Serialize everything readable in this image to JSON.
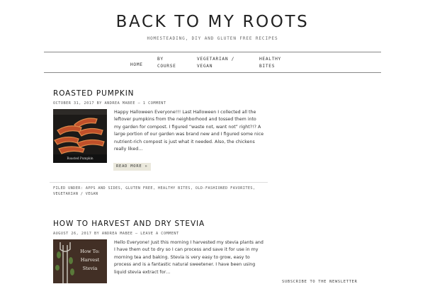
{
  "header": {
    "title": "BACK TO MY ROOTS",
    "tagline": "HOMESTEADING, DIY AND GLUTEN FREE RECIPES"
  },
  "nav": {
    "home": "HOME",
    "by_course": "BY\nCOURSE",
    "vegetarian_vegan": "VEGETARIAN /\nVEGAN",
    "healthy_bites": "HEALTHY\nBITES"
  },
  "posts": [
    {
      "title": "ROASTED PUMPKIN",
      "date": "OCTOBER 31, 2017",
      "by": "BY",
      "author": "ANDREA MABEE",
      "sep": "—",
      "comments": "1 COMMENT",
      "excerpt": "Happy Halloween Everyone!!! Last Halloween I collected all the leftover pumpkins from the neighborhood and tossed them into my garden for compost. I figured “waste not, want not” right?!? A large portion of our garden was brand new and I figured some nice nutrient-rich compost is just what it needed. Also, the chickens really liked…",
      "read_more": "READ MORE »",
      "image_caption": "Roasted Pumpkin",
      "filed_label": "FILED UNDER:",
      "categories": [
        "APPS AND SIDES",
        "GLUTEN FREE",
        "HEALTHY BITES",
        "OLD-FASHIONED FAVORITES",
        "VEGETARIAN / VEGAN"
      ]
    },
    {
      "title": "HOW TO HARVEST AND DRY STEVIA",
      "date": "AUGUST 26, 2017",
      "by": "BY",
      "author": "ANDREA MABEE",
      "sep": "—",
      "comments": "LEAVE A COMMENT",
      "excerpt": "Hello Everyone! Just this morning I harvested my stevia plants and I have them out to dry so I can process and save it for use in my morning tea and baking. Stevia is very easy to grow, easy to process and is a fantastic natural sweetener. I have been using liquid stevia extract for…",
      "image_lines": [
        "How To:",
        "Harvest",
        "Stevia"
      ]
    }
  ],
  "sidebar": {
    "heading": "SUBSCRIBE TO THE NEWSLETTER"
  },
  "colors": {
    "read_more_bg": "#eae8dc",
    "pan": "#1c1a18",
    "pumpkin": "#c0502a",
    "stevia_bg": "#3a2a22"
  }
}
